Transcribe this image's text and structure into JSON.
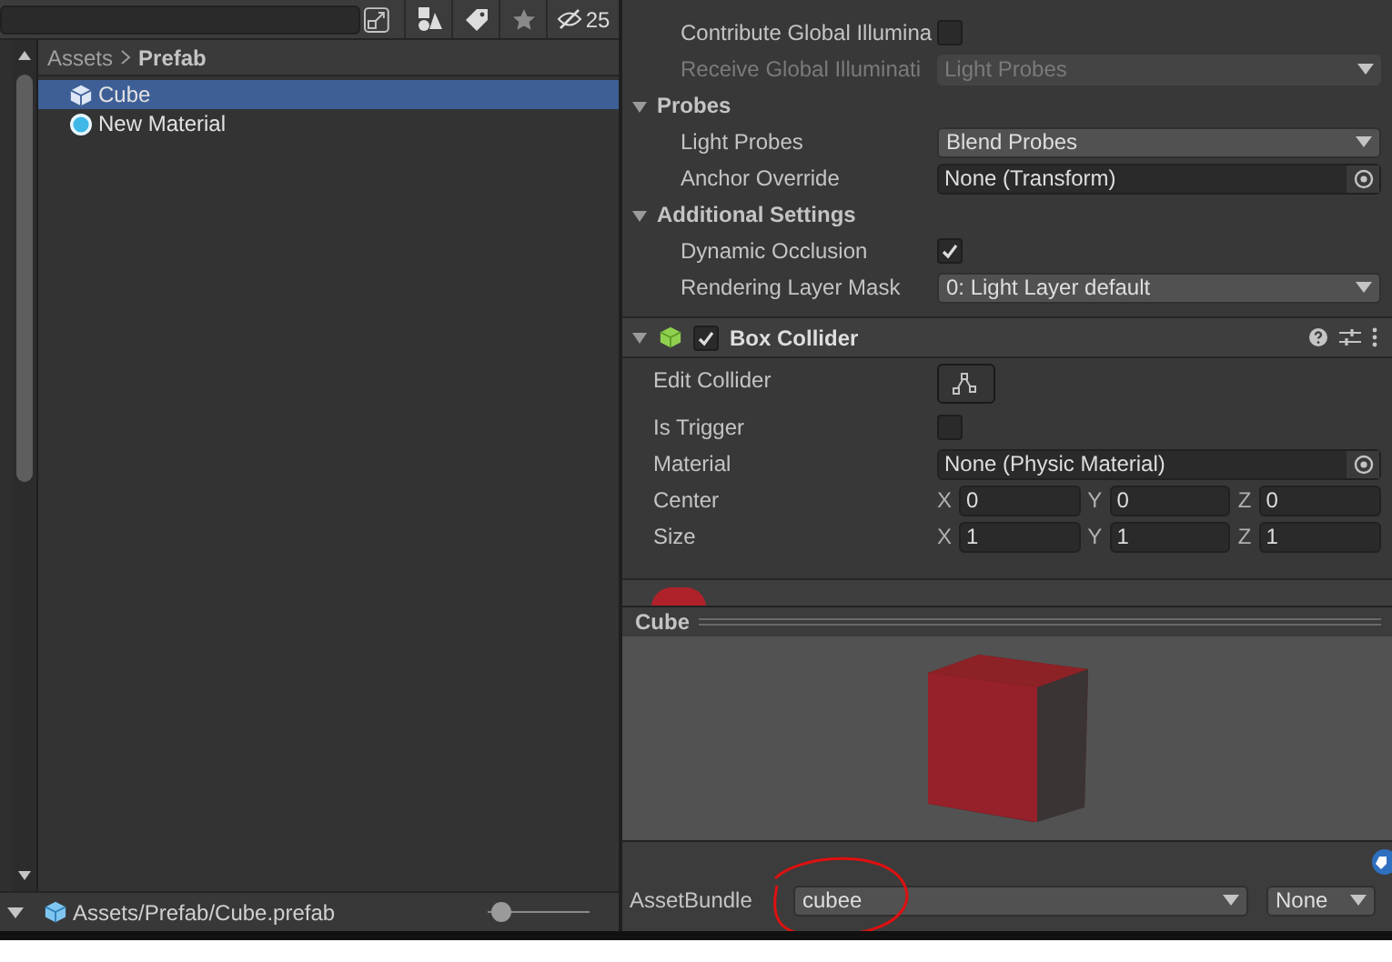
{
  "toolbar": {
    "hidden_count": "25"
  },
  "breadcrumb": [
    {
      "label": "Assets",
      "current": false
    },
    {
      "label": "Prefab",
      "current": true
    }
  ],
  "assets": [
    {
      "label": "Cube",
      "kind": "prefab",
      "selected": true
    },
    {
      "label": "New Material",
      "kind": "material",
      "selected": false
    }
  ],
  "status_bar": {
    "path": "Assets/Prefab/Cube.prefab",
    "zoom": {
      "level": 0.05
    }
  },
  "inspector": {
    "rows": [
      {
        "kind": "checkbox",
        "label": "Contribute Global Illumina",
        "checked": false,
        "disabled": false
      },
      {
        "kind": "dropdown",
        "label": "Receive Global Illuminati",
        "value": "Light Probes",
        "disabled": true
      },
      {
        "kind": "section",
        "label": "Probes",
        "expanded": true
      },
      {
        "kind": "dropdown",
        "label": "Light Probes",
        "value": "Blend Probes",
        "disabled": false
      },
      {
        "kind": "object",
        "label": "Anchor Override",
        "value": "None (Transform)"
      },
      {
        "kind": "section",
        "label": "Additional Settings",
        "expanded": true
      },
      {
        "kind": "checkbox",
        "label": "Dynamic Occlusion",
        "checked": true,
        "disabled": false
      },
      {
        "kind": "dropdown",
        "label": "Rendering Layer Mask",
        "value": "0: Light Layer default",
        "disabled": false
      },
      {
        "kind": "component",
        "label": "Box Collider",
        "checked": true,
        "expanded": true
      },
      {
        "kind": "button",
        "label": "Edit Collider"
      },
      {
        "kind": "checkbox",
        "label": "Is Trigger",
        "checked": false,
        "disabled": false
      },
      {
        "kind": "object",
        "label": "Material",
        "value": "None (Physic Material)"
      },
      {
        "kind": "vector",
        "label": "Center",
        "axes": [
          {
            "axis": "X",
            "value": "0"
          },
          {
            "axis": "Y",
            "value": "0"
          },
          {
            "axis": "Z",
            "value": "0"
          }
        ]
      },
      {
        "kind": "vector",
        "label": "Size",
        "axes": [
          {
            "axis": "X",
            "value": "1"
          },
          {
            "axis": "Y",
            "value": "1"
          },
          {
            "axis": "Z",
            "value": "1"
          }
        ]
      }
    ]
  },
  "preview": {
    "title": "Cube"
  },
  "asset_bundle": {
    "label": "AssetBundle",
    "name": "cubee",
    "variant": "None"
  }
}
